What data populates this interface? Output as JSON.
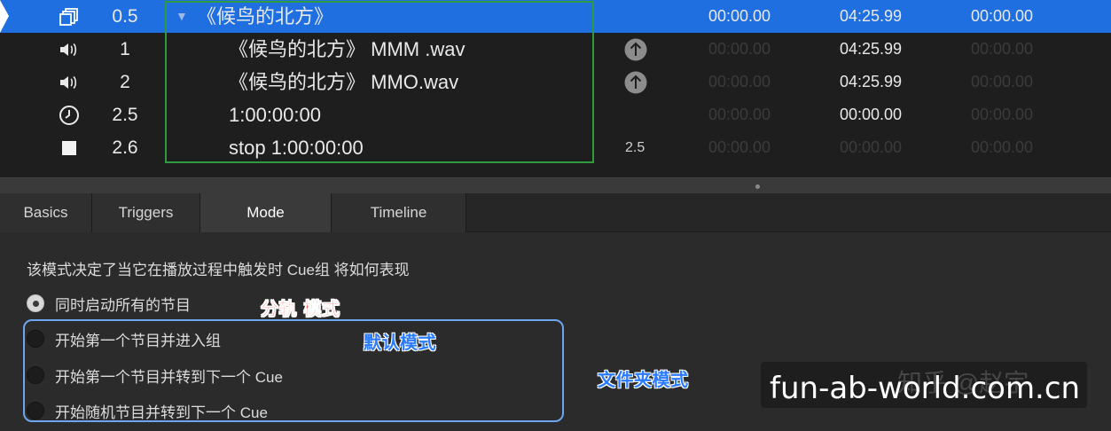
{
  "cue_list": {
    "rows": [
      {
        "type_icon": "group-icon",
        "number": "0.5",
        "name": "《候鸟的北方》",
        "times": [
          "00:00.00",
          "04:25.99",
          "00:00.00"
        ],
        "selected": true
      },
      {
        "type_icon": "speaker-icon",
        "number": "1",
        "name": "《候鸟的北方》 MMM .wav",
        "target_icon": "up-arrow-icon",
        "times": [
          "00:00.00",
          "04:25.99",
          "00:00.00"
        ]
      },
      {
        "type_icon": "speaker-icon",
        "number": "2",
        "name": "《候鸟的北方》 MMO.wav",
        "target_icon": "up-arrow-icon",
        "times": [
          "00:00.00",
          "04:25.99",
          "00:00.00"
        ]
      },
      {
        "type_icon": "clock-icon",
        "number": "2.5",
        "name": "1:00:00:00",
        "times": [
          "00:00.00",
          "00:00.00",
          "00:00.00"
        ]
      },
      {
        "type_icon": "stop-icon",
        "number": "2.6",
        "name": "stop 1:00:00:00",
        "target": "2.5",
        "times": [
          "00:00.00",
          "00:00.00",
          "00:00.00"
        ]
      }
    ]
  },
  "tabs": [
    {
      "label": "Basics"
    },
    {
      "label": "Triggers"
    },
    {
      "label": "Mode",
      "active": true
    },
    {
      "label": "Timeline"
    }
  ],
  "mode_panel": {
    "description": "该模式决定了当它在播放过程中触发时 Cue组 将如何表现",
    "options": [
      {
        "label": "同时启动所有的节目",
        "selected": true
      },
      {
        "label": "开始第一个节目并进入组",
        "selected": false
      },
      {
        "label": "开始第一个节目并转到下一个 Cue",
        "selected": false
      },
      {
        "label": "开始随机节目并转到下一个 Cue",
        "selected": false
      }
    ]
  },
  "annotations": {
    "red": "分轨 模式",
    "blue_default": "默认模式",
    "blue_folder": "文件夹模式"
  },
  "watermark": {
    "faint": "知乎 @赵宇",
    "main": "fun-ab-world.com.cn"
  },
  "colors": {
    "selection": "#1f6fe0",
    "group_box": "#2f9a3e",
    "options_box": "#6da6f0",
    "annotation_red": "#ff3b2f",
    "annotation_blue": "#2a7bff"
  }
}
